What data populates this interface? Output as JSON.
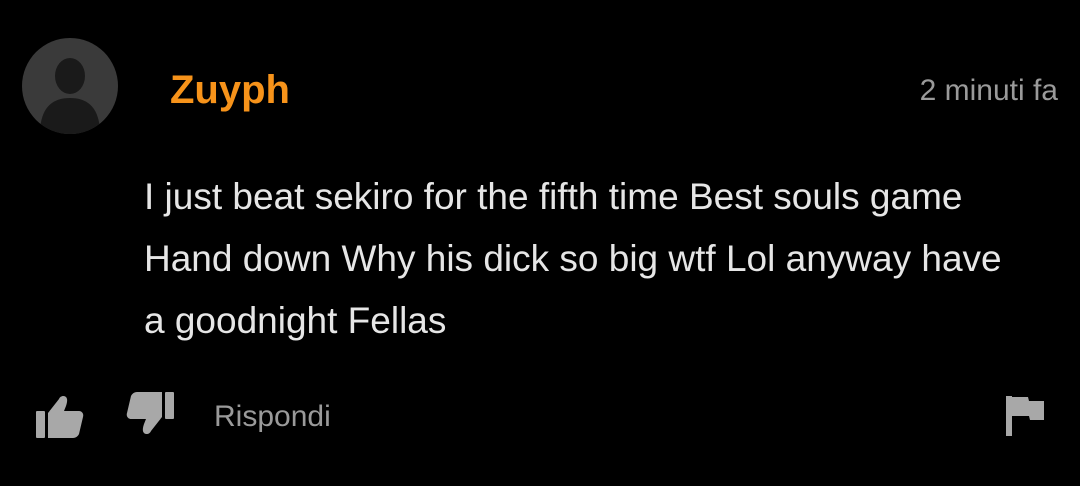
{
  "comment": {
    "username": "Zuyph",
    "timestamp": "2 minuti fa",
    "text": "I just beat sekiro for the fifth time Best souls game Hand down Why his dick so big wtf Lol anyway have a goodnight Fellas",
    "reply_label": "Rispondi"
  },
  "icons": {
    "avatar": "user-silhouette-icon",
    "like": "thumbs-up-icon",
    "dislike": "thumbs-down-icon",
    "report": "flag-icon"
  },
  "colors": {
    "background": "#000000",
    "username": "#f7931a",
    "text": "#e6e6e6",
    "muted": "#9a9a9a",
    "icon": "#a8a8a8"
  }
}
